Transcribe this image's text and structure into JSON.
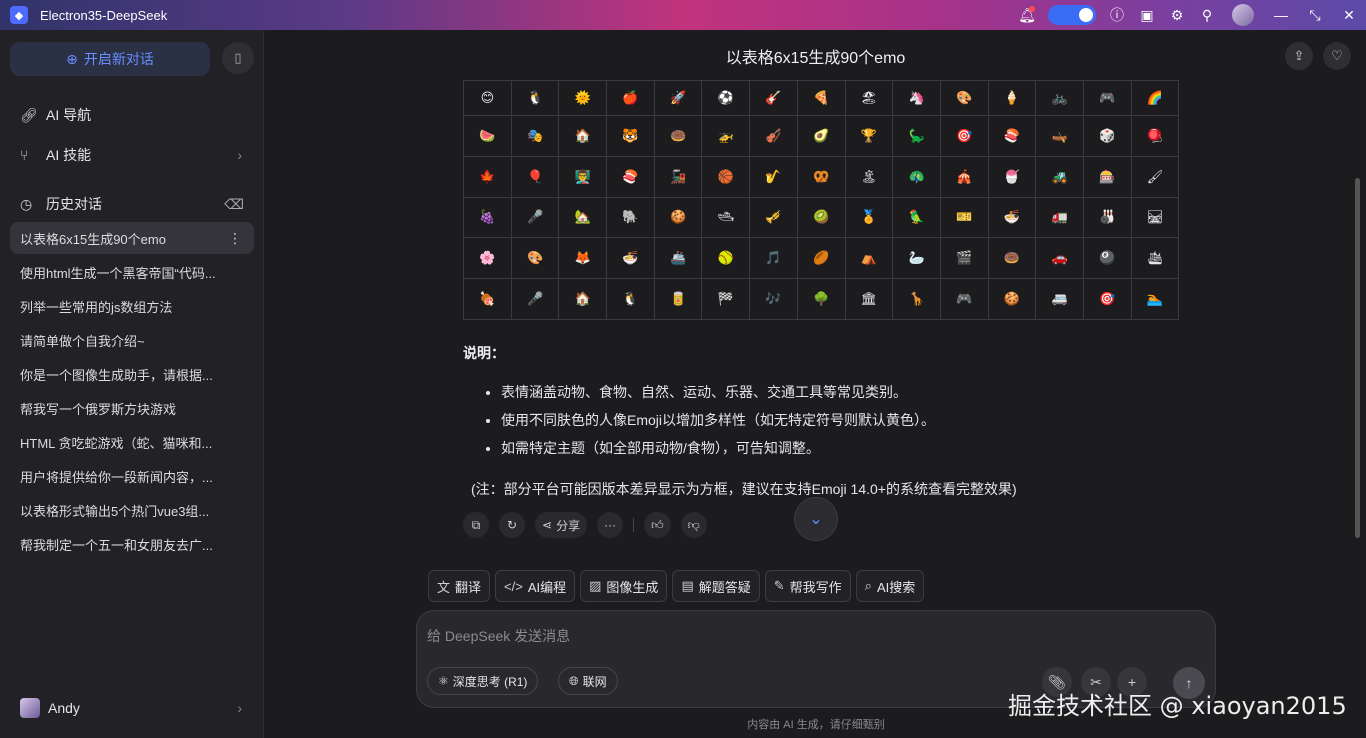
{
  "window": {
    "title": "Electron35-DeepSeek",
    "accent": "#4d6bfe"
  },
  "sidebar": {
    "new_chat_label": "开启新对话",
    "nav": [
      {
        "label": "AI 导航",
        "icon": "link-icon"
      },
      {
        "label": "AI 技能",
        "icon": "branch-icon"
      }
    ],
    "history_label": "历史对话",
    "history": [
      "以表格6x15生成90个emo",
      "使用html生成一个黑客帝国“代码...",
      "列举一些常用的js数组方法",
      "请简单做个自我介绍~",
      "你是一个图像生成助手，请根据...",
      "帮我写一个俄罗斯方块游戏",
      "HTML 贪吃蛇游戏（蛇、猫咪和...",
      "用户将提供给你一段新闻内容，...",
      "以表格形式输出5个热门vue3组...",
      "帮我制定一个五一和女朋友去广..."
    ],
    "user_name": "Andy"
  },
  "chat": {
    "title": "以表格6x15生成90个emo",
    "emoji_rows": [
      [
        "😊",
        "🐧",
        "🌞",
        "🍎",
        "🚀",
        "⚽",
        "🎸",
        "🍕",
        "🏖",
        "🦄",
        "🎨",
        "🍦",
        "🚲",
        "🎮",
        "🌈"
      ],
      [
        "🍉",
        "🎭",
        "🏠",
        "🐯",
        "🍩",
        "🚁",
        "🎻",
        "🥑",
        "🏆",
        "🦕",
        "🎯",
        "🍣",
        "🛶",
        "🎲",
        "🪀"
      ],
      [
        "🍁",
        "🎈",
        "👨‍🏫",
        "🍣",
        "🚂",
        "🏀",
        "🎷",
        "🥨",
        "🏝",
        "🦚",
        "🎪",
        "🍧",
        "🚜",
        "🎰",
        "🖌"
      ],
      [
        "🍇",
        "🎤",
        "🏡",
        "🐘",
        "🍪",
        "🛥",
        "🎺",
        "🥝",
        "🏅",
        "🦜",
        "🎫",
        "🍜",
        "🚛",
        "🎳",
        "🛤"
      ],
      [
        "🌸",
        "🎨",
        "🦊",
        "🍜",
        "🚢",
        "🥎",
        "🎵",
        "🏉",
        "⛺",
        "🦢",
        "🎬",
        "🍩",
        "🚗",
        "🎱",
        "🛳"
      ],
      [
        "🍖",
        "🎤",
        "🏠",
        "🐧",
        "🥫",
        "🏁",
        "🎶",
        "🌳",
        "🏛",
        "🦒",
        "🎮",
        "🍪",
        "🚐",
        "🎯",
        "🏊"
      ]
    ],
    "note_label": "说明：",
    "bullets": [
      "表情涵盖动物、食物、自然、运动、乐器、交通工具等常见类别。",
      "使用不同肤色的人像Emoji以增加多样性（如无特定符号则默认黄色）。",
      "如需特定主题（如全部用动物/食物），可告知调整。"
    ],
    "footnote": "(注：部分平台可能因版本差异显示为方框，建议在支持Emoji 14.0+的系统查看完整效果)",
    "share_label": "分享"
  },
  "tools": [
    {
      "label": "翻译",
      "icon": "translate-icon"
    },
    {
      "label": "AI编程",
      "icon": "code-icon"
    },
    {
      "label": "图像生成",
      "icon": "image-icon"
    },
    {
      "label": "解题答疑",
      "icon": "doc-icon"
    },
    {
      "label": "帮我写作",
      "icon": "pen-icon"
    },
    {
      "label": "AI搜索",
      "icon": "search-icon"
    }
  ],
  "composer": {
    "placeholder": "给 DeepSeek 发送消息",
    "deep_think_label": "深度思考 (R1)",
    "web_label": "联网"
  },
  "disclaimer": "内容由 AI 生成，请仔细甄别",
  "watermark": "掘金技术社区 @ xiaoyan2015"
}
